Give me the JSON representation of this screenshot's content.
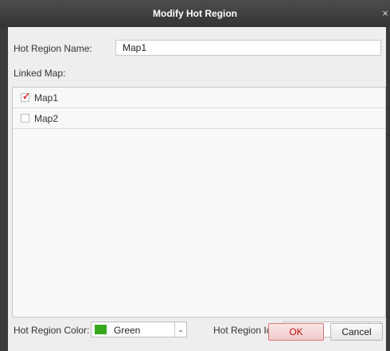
{
  "window": {
    "title": "Modify Hot Region",
    "close_glyph": "×"
  },
  "form": {
    "name_label": "Hot Region Name:",
    "name_value": "Map1",
    "linked_map_label": "Linked Map:",
    "maps": [
      {
        "name": "Map1",
        "checked": true
      },
      {
        "name": "Map2",
        "checked": false
      }
    ],
    "color_label": "Hot Region Color:",
    "color_value": "Green",
    "color_hex": "#37a81c",
    "icon_label": "Hot Region Icon:",
    "icon_name": "hot-region-flag-icon"
  },
  "buttons": {
    "ok": "OK",
    "cancel": "Cancel"
  },
  "icons": {
    "dropdown": "⌄",
    "check": "✓"
  }
}
